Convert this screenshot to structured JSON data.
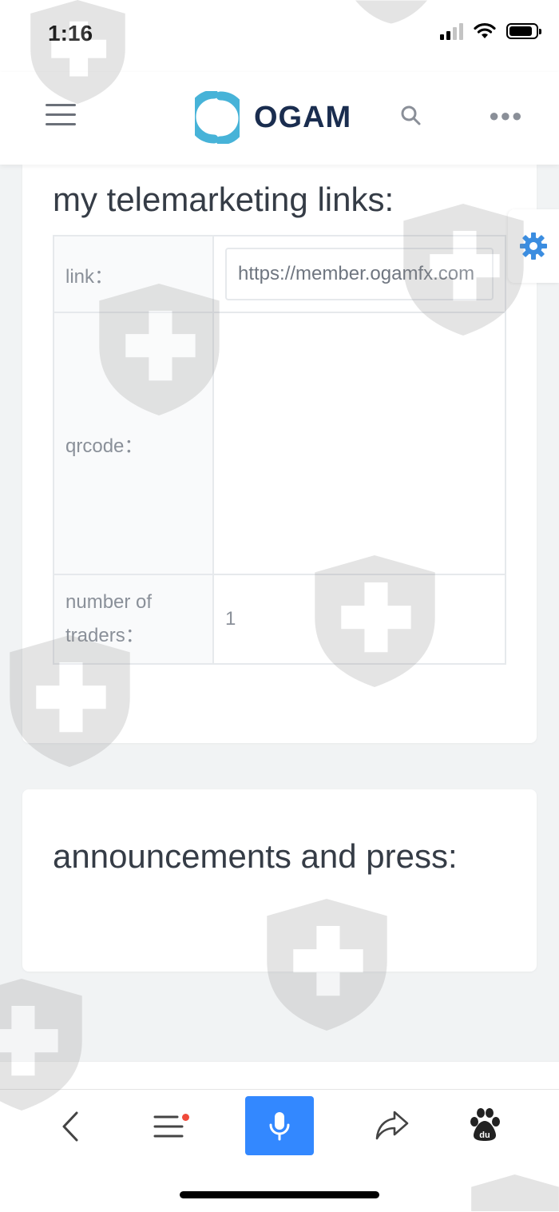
{
  "status_bar": {
    "time": "1:16"
  },
  "navbar": {
    "logo_text": "OGAM",
    "logo_colors": [
      "#47b3d8",
      "#1a2d4f"
    ],
    "icons": [
      "menu-icon",
      "search-icon",
      "more-icon"
    ]
  },
  "telemarketing": {
    "title": "my telemarketing links:",
    "link_label": "link：",
    "link_value": "https://member.ogamfx.com",
    "qrcode_label": "qrcode：",
    "traders_label_line1": "number of",
    "traders_label_line2": "traders：",
    "traders_value": "1"
  },
  "announcements": {
    "title": "announcements and press:"
  },
  "browser_bar": {
    "icons": [
      "back-icon",
      "menu-icon",
      "microphone-icon",
      "share-icon",
      "baidu-icon"
    ],
    "accent": "#3388ff",
    "notification_color": "#f04a3a"
  },
  "colors": {
    "background": "#f1f3f4",
    "card": "#ffffff",
    "heading": "#353c46",
    "gear": "#3b8de0"
  }
}
